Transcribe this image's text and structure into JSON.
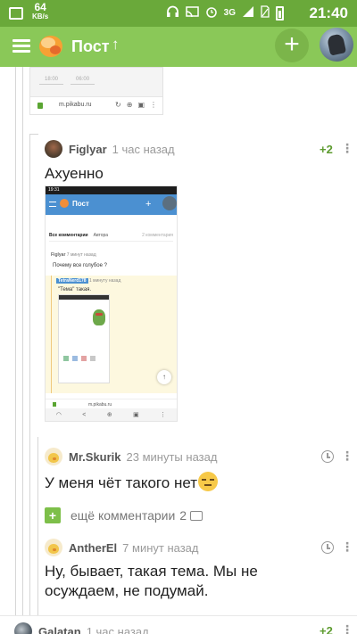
{
  "status_bar": {
    "speed": "64",
    "speed_unit": "KB/s",
    "network": "3G",
    "time": "21:40"
  },
  "app_bar": {
    "title": "Пост",
    "up_arrow": "↑",
    "plus": "+"
  },
  "fragment": {
    "time_from": "18:00",
    "time_to": "06:00",
    "url": "m.pikabu.ru"
  },
  "comments": [
    {
      "nick": "Figlyar",
      "time": "1 час назад",
      "rating": "+2",
      "text": "Ахуенно"
    },
    {
      "nick": "Mr.Skurik",
      "time": "23 минуты назад",
      "text": "У меня чёт такого нет"
    },
    {
      "nick": "AntherEl",
      "time": "7 минут назад",
      "text": "Ну, бывает, такая тема. Мы не осуждаем, не подумай."
    },
    {
      "nick": "Galatan",
      "time": "1 час назад",
      "rating": "+2"
    }
  ],
  "more_comments": {
    "label": "ещё комментарии",
    "count": "2"
  },
  "embedded": {
    "title": "Пост",
    "tab_all": "Все комментарии",
    "tab_author": "Автора",
    "count": "2 комментария",
    "c1_nick": "Figlyar",
    "c1_time": "7 минут назад",
    "c1_text": "Почему все голубое ?",
    "c2_nick": "TetraNerd178",
    "c2_time": "1 минуту назад",
    "c2_text": "\"Тема\" такая.",
    "url": "m.pikabu.ru"
  },
  "icons": {
    "menu": "menu-icon",
    "more": "more-vert-icon",
    "clock": "clock-icon",
    "comment": "comment-bubble-icon"
  },
  "colors": {
    "status_bar": "#6aa93a",
    "app_bar": "#8ac858",
    "accent": "#5d9b2f"
  }
}
